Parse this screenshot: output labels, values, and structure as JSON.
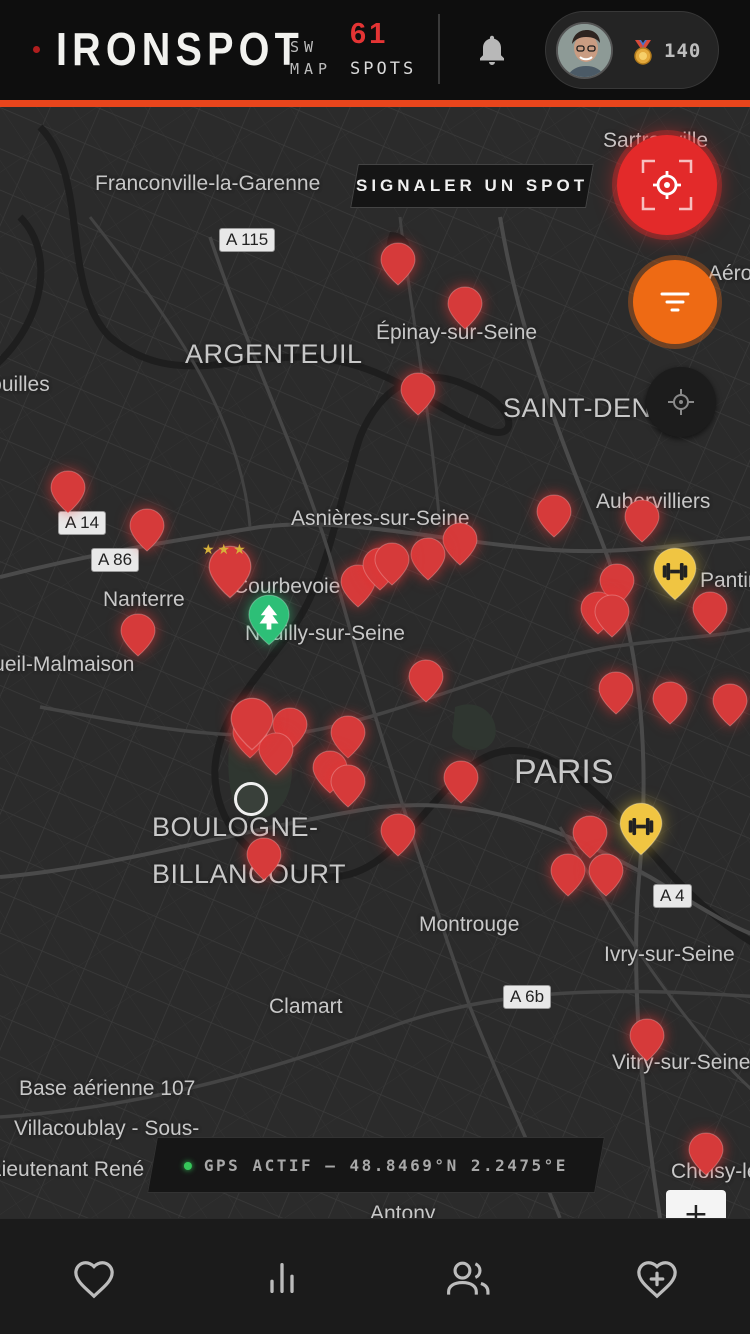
{
  "header": {
    "brand": "IRONSPOT",
    "subtitle_line1": "SW",
    "subtitle_line2": "MAP",
    "spot_count": "61",
    "spot_label": "SPOTS",
    "notifications_icon": "bell-icon",
    "profile": {
      "avatar": "user-avatar",
      "medal_icon": "medal-icon",
      "points": "140"
    }
  },
  "colors": {
    "accent": "#e8451c",
    "pin_red": "#d63a3a",
    "pin_gold": "#f0c542",
    "pin_green": "#2dbf77",
    "scan_button": "#e32a2a",
    "filter_button": "#ee6a14",
    "gps_active": "#36c75a"
  },
  "map": {
    "report_button": "SIGNALER UN SPOT",
    "scan_icon": "scan-target-icon",
    "filter_icon": "filter-icon",
    "locate_icon": "crosshair-icon",
    "zoom_in": "+",
    "gps_status": "GPS ACTIF — 48.8469°N 2.2475°E",
    "place_labels": [
      "Franconville-la-Garenne",
      "ARGENTEUIL",
      "Épinay-sur-Seine",
      "SAINT-DENIS",
      "Aubervilliers",
      "Asnières-sur-Seine",
      "Nanterre",
      "Courbevoie",
      "Neuilly-sur-Seine",
      "Rueil-Malmaison",
      "PARIS",
      "BOULOGNE-",
      "BILLANCOURT",
      "Montrouge",
      "Ivry-sur-Seine",
      "Clamart",
      "Base aérienne 107",
      "Villacoublay - Sous-",
      "Lieutenant René",
      "Vitry-sur-Seine",
      "Choisy-le-Roi",
      "Antony",
      "Sartrouville",
      "Pantin",
      "Aéroport",
      "Houilles"
    ],
    "road_labels": [
      "A 115",
      "A 14",
      "A 86",
      "A 4",
      "A 6b"
    ]
  },
  "tabbar": {
    "tabs": [
      {
        "name": "favorites",
        "icon": "heart-icon"
      },
      {
        "name": "stats",
        "icon": "bar-chart-icon"
      },
      {
        "name": "community",
        "icon": "users-icon"
      },
      {
        "name": "add-favorite",
        "icon": "heart-plus-icon"
      }
    ]
  }
}
